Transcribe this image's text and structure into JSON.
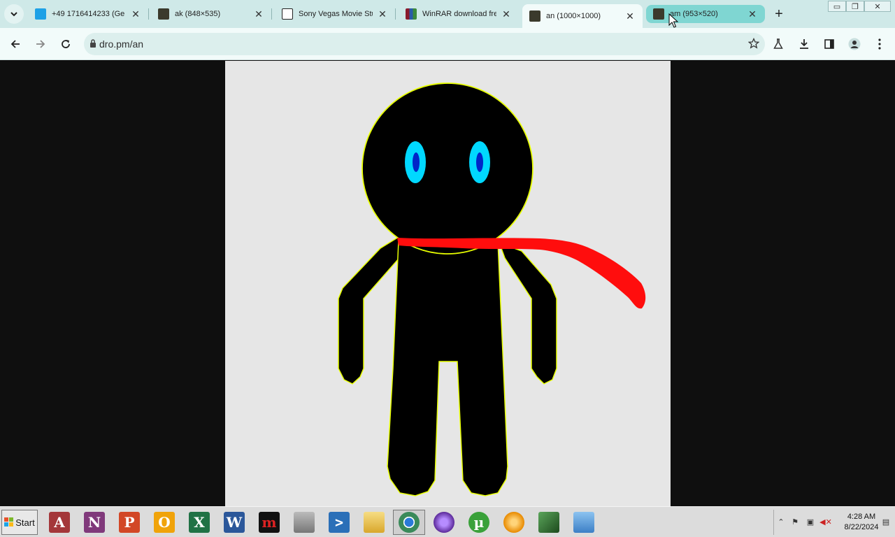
{
  "browser": {
    "tabs": [
      {
        "title": "+49 1716414233 (Ge",
        "favicon": "messages-icon",
        "color": "#1ea1e6"
      },
      {
        "title": "ak (848×535)",
        "favicon": "image-thumbnail-icon",
        "color": "#3b3a2c"
      },
      {
        "title": "Sony Vegas Movie Stu",
        "favicon": "archive-building-icon",
        "color": "#222222"
      },
      {
        "title": "WinRAR download fre",
        "favicon": "winrar-icon",
        "color": "#8a1b2c"
      },
      {
        "title": "an (1000×1000)",
        "favicon": "image-thumbnail-icon",
        "color": "#3b3a2c"
      },
      {
        "title": "am (953×520)",
        "favicon": "image-thumbnail-icon",
        "color": "#3b3a2c"
      }
    ],
    "active_tab_index": 4,
    "hover_tab_index": 5,
    "url": "dro.pm/an"
  },
  "image": {
    "description_colors": {
      "background": "#e6e6e6",
      "figure": "#000000",
      "outline": "#e8ff00",
      "eye_outer": "#00d8ff",
      "eye_inner": "#0026c8",
      "scarf": "#ff0000"
    }
  },
  "taskbar": {
    "start_label": "Start",
    "apps": [
      {
        "name": "access-icon",
        "letter": "A",
        "color": "#a4373a"
      },
      {
        "name": "onenote-icon",
        "letter": "N",
        "color": "#80397b"
      },
      {
        "name": "powerpoint-icon",
        "letter": "P",
        "color": "#d24726"
      },
      {
        "name": "outlook-icon",
        "letter": "O",
        "color": "#f0a30a"
      },
      {
        "name": "excel-icon",
        "letter": "X",
        "color": "#207245"
      },
      {
        "name": "word-icon",
        "letter": "W",
        "color": "#2b579a"
      },
      {
        "name": "media-player-icon",
        "letter": "m",
        "color": "#111111"
      },
      {
        "name": "printer-icon",
        "letter": "",
        "color": "#8c8c8c"
      },
      {
        "name": "powershell-icon",
        "letter": ">",
        "color": "#2a6fb8"
      },
      {
        "name": "file-explorer-icon",
        "letter": "",
        "color": "#e8c24a"
      },
      {
        "name": "chrome-icon",
        "letter": "",
        "color": "#3a8a5a"
      },
      {
        "name": "torrent-client-icon",
        "letter": "",
        "color": "#5c2a9a"
      },
      {
        "name": "utorrent-icon",
        "letter": "µ",
        "color": "#3aa13a"
      },
      {
        "name": "vlc-icon",
        "letter": "",
        "color": "#e88a00"
      },
      {
        "name": "graphics-card-icon",
        "letter": "",
        "color": "#2e6d2e"
      },
      {
        "name": "remote-desktop-icon",
        "letter": "",
        "color": "#3c7fc6"
      }
    ],
    "pressed_app_index": 10,
    "clock_time": "4:28 AM",
    "clock_date": "8/22/2024"
  }
}
